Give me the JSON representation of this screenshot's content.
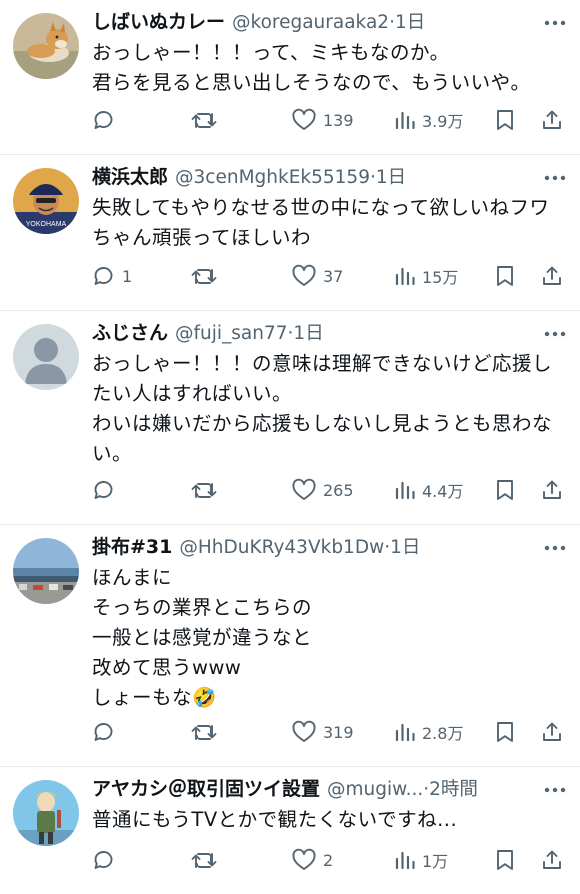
{
  "tweets": [
    {
      "name": "しばいぬカレー",
      "handle": "@koregauraaka2",
      "sep": "·",
      "time": "1日",
      "text": "おっしゃー！！！って、ミキもなのか。\n君らを見ると思い出しそうなので、もういいや。",
      "replies": "",
      "retweets": "",
      "likes": "139",
      "views": "3.9万",
      "avatar": "shiba-dog-photo"
    },
    {
      "name": "横浜太郎",
      "handle": "@3cenMghkEk55159",
      "sep": "·",
      "time": "1日",
      "text": "失敗してもやりなせる世の中になって欲しいねフワちゃん頑張ってほしいわ",
      "replies": "1",
      "retweets": "",
      "likes": "37",
      "views": "15万",
      "avatar": "yokohama-player-illustration"
    },
    {
      "name": "ふじさん",
      "handle": "@fuji_san77",
      "sep": "·",
      "time": "1日",
      "text": "おっしゃー！！！の意味は理解できないけど応援したい人はすればいい。\nわいは嫌いだから応援もしないし見ようとも思わない。",
      "replies": "",
      "retweets": "",
      "likes": "265",
      "views": "4.4万",
      "avatar": "default-person-avatar"
    },
    {
      "name": "掛布#31",
      "handle": "@HhDuKRy43Vkb1Dw",
      "sep": "·",
      "time": "1日",
      "text": "ほんまに\nそっちの業界とこちらの\n一般とは感覚が違うなと\n改めて思うwww\nしょーもな🤣",
      "replies": "",
      "retweets": "",
      "likes": "319",
      "views": "2.8万",
      "avatar": "seaside-photo"
    },
    {
      "name": "アヤカシ＠取引固ツイ設置",
      "handle": "@mugiw...",
      "sep": "·",
      "time": "2時間",
      "text": "普通にもうTVとかで観たくないですね...",
      "replies": "",
      "retweets": "",
      "likes": "2",
      "views": "1万",
      "avatar": "anime-character-illustration"
    }
  ],
  "icons": [
    "reply-icon",
    "retweet-icon",
    "like-icon",
    "views-icon",
    "bookmark-icon",
    "share-icon",
    "more-icon"
  ],
  "colors": {
    "text": "#0f1419",
    "muted": "#536471",
    "divider": "#e6e9ec"
  }
}
